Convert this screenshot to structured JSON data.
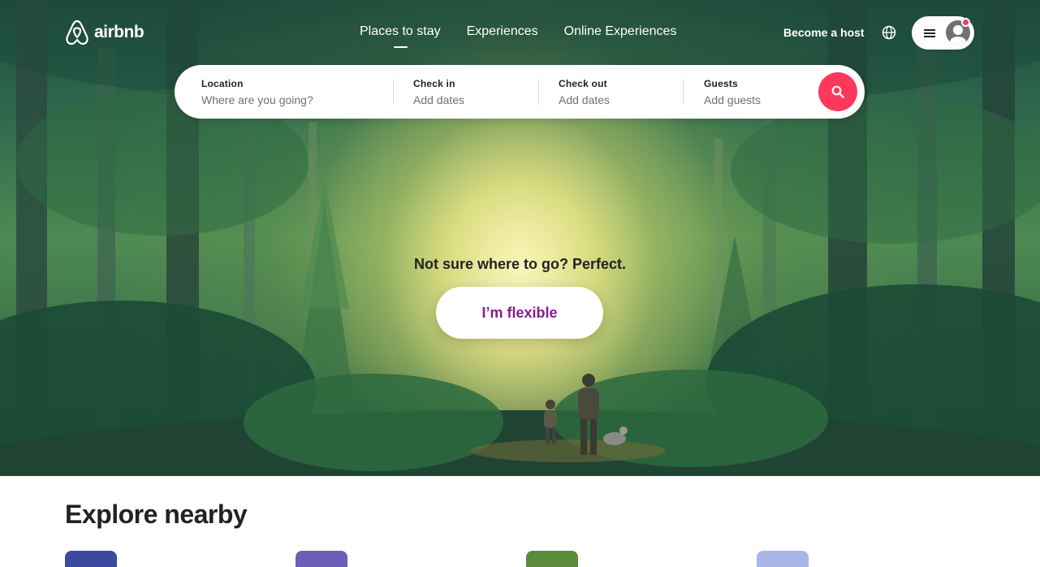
{
  "header": {
    "brand": "airbnb",
    "tabs": [
      {
        "label": "Places to stay",
        "active": true
      },
      {
        "label": "Experiences",
        "active": false
      },
      {
        "label": "Online Experiences",
        "active": false
      }
    ],
    "host_link": "Become a host",
    "globe_icon": "globe-icon",
    "menu_icon": "hamburger-menu-icon",
    "avatar_icon": "user-avatar-icon",
    "notification": true
  },
  "search": {
    "location_label": "Location",
    "location_placeholder": "Where are you going?",
    "checkin_label": "Check in",
    "checkin_value": "Add dates",
    "checkout_label": "Check out",
    "checkout_value": "Add dates",
    "guests_label": "Guests",
    "guests_value": "Add guests",
    "button_icon": "search-icon"
  },
  "hero": {
    "tagline": "Not sure where to go? Perfect.",
    "cta": "I’m flexible"
  },
  "explore": {
    "title": "Explore nearby",
    "thumbnails": [
      {
        "color": "#3b4aa0"
      },
      {
        "color": "#6b5fb8"
      },
      {
        "color": "#5a8a3a"
      },
      {
        "color": "#a9b6e8"
      }
    ]
  },
  "colors": {
    "brand": "#ff385c",
    "cta_text": "#8a1a8f"
  }
}
